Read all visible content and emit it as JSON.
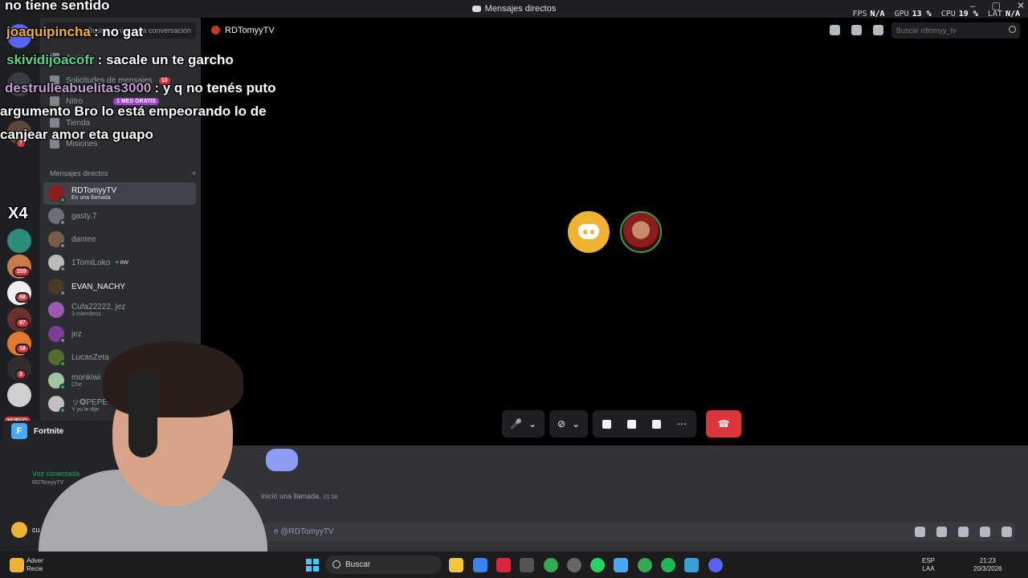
{
  "titlebar": {
    "title": "Mensajes directos",
    "fps_label": "FPS",
    "fps_value": "N/A",
    "gpu_label": "GPU",
    "gpu_value": "13 %",
    "cpu_label": "CPU",
    "cpu_value": "19 %",
    "lat_label": "LAT",
    "lat_value": "N/A"
  },
  "rail": {
    "badges": [
      "7",
      "209",
      "69",
      "97",
      "18",
      "3"
    ],
    "new_badge": "NUEVO"
  },
  "sidebar": {
    "conversation_button": "Busca o inicia una conversación",
    "items": [
      {
        "label": "Amigos",
        "badge": ""
      },
      {
        "label": "Solicitudes de mensajes",
        "badge": "10"
      },
      {
        "label": "Nitro",
        "badge": "1 MES GRATIS"
      },
      {
        "label": "Tienda",
        "badge": ""
      },
      {
        "label": "Misiones",
        "badge": ""
      }
    ],
    "dm_header": "Mensajes directos",
    "dm_add": "+",
    "dms": [
      {
        "name": "RDTomyyTV",
        "sub": "En una llamada"
      },
      {
        "name": "gasty.7",
        "sub": ""
      },
      {
        "name": "dantee",
        "sub": ""
      },
      {
        "name": "1TomiLoko",
        "sub": ""
      },
      {
        "name": "EVAN_NACHY",
        "sub": ""
      },
      {
        "name": "Cufa22222, jez",
        "sub": "3 miembros"
      },
      {
        "name": "jez",
        "sub": ""
      },
      {
        "name": "LucasZeta",
        "sub": ""
      },
      {
        "name": "monkiwi",
        "sub": "Che"
      },
      {
        "name": "ッ✪PEPE✪ツ",
        "sub": "Y yo le dije"
      }
    ],
    "tomiloko_tag": "#W",
    "game": "Fortnite",
    "voice_label": "Voz conectada",
    "voice_sub": "RDTomyyTV",
    "user_name": "cu"
  },
  "header": {
    "channel": "RDTomyyTV",
    "search_placeholder": "Buscar rdtomyy_tv"
  },
  "call": {
    "started_text": "inició una llamada.",
    "started_time": "21:18",
    "input_placeholder": "e @RDTomyyTV"
  },
  "overlay_chat": [
    {
      "user": "",
      "text": "no tiene sentido"
    },
    {
      "user": "joaquipincha",
      "text": ": no gat"
    },
    {
      "user": "skividijoacofr",
      "text": ": sacale un te garcho"
    },
    {
      "user": "destrulleabuelitas3000",
      "text": ": y q no tenés puto"
    },
    {
      "user": "",
      "text": "argumento Bro lo está empeorando lo de"
    },
    {
      "user": "",
      "text": "canjear amor eta guapo"
    }
  ],
  "overlay_x4": "X4",
  "taskbar": {
    "search": "Buscar",
    "widget_title": "Adver",
    "widget_sub": "Recie",
    "lang_top": "ESP",
    "lang_bottom": "LAA",
    "time": "21:23",
    "date": "20/3/2026"
  }
}
